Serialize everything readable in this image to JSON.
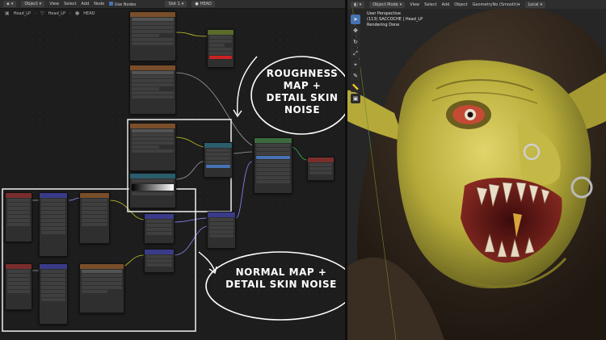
{
  "editor": {
    "header": {
      "mode": "Object",
      "menus": [
        "View",
        "Select",
        "Add",
        "Node"
      ],
      "use_nodes": "Use Nodes",
      "slot": "Slot 1",
      "material": "HEAD"
    },
    "breadcrumb": [
      "Head_LP",
      "Head_LP",
      "HEAD"
    ],
    "annotations": {
      "roughness": [
        "ROUGHNESS",
        "MAP +",
        "DETAIL SKIN",
        "NOISE"
      ],
      "normal": [
        "NORMAL MAP +",
        "DETAIL SKIN NOISE"
      ]
    }
  },
  "viewport": {
    "header": {
      "mode": "Object Mode",
      "menus": [
        "View",
        "Select",
        "Add",
        "Object"
      ],
      "extra": "GeometryNo (Smooth)",
      "transform": "Local"
    },
    "info": {
      "line1": "User Perspective",
      "line2": "(113) SACCOCHE | Head_LP",
      "line3": "Rendering Done"
    },
    "tool_icons": [
      "cursor-icon",
      "move-icon",
      "rotate-icon",
      "scale-icon",
      "transform-icon",
      "annotate-icon",
      "measure-icon",
      "add-cube-icon"
    ]
  },
  "colors": {
    "accent": "#4772b3",
    "annotation": "#ffffff",
    "skin": "#c9bf4a"
  }
}
